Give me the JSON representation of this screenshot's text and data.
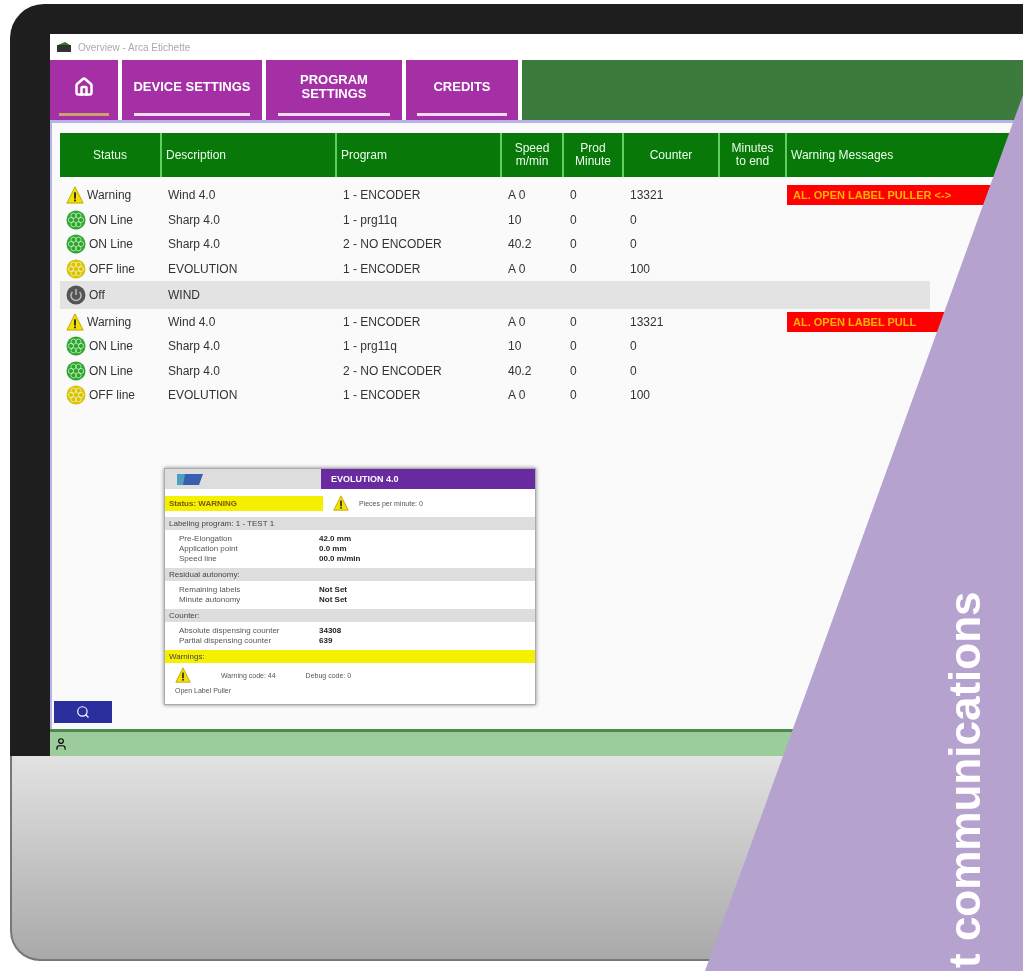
{
  "window": {
    "title": "Overview - Arca Etichette"
  },
  "nav": [
    {
      "kind": "home",
      "selected": true
    },
    {
      "kind": "text",
      "label": "DEVICE SETTINGS",
      "selected": false
    },
    {
      "kind": "text",
      "label": "PROGRAM\nSETTINGS",
      "selected": false
    },
    {
      "kind": "text",
      "label": "CREDITS",
      "selected": false
    }
  ],
  "table": {
    "columns": [
      "Status",
      "Description",
      "Program",
      "Speed\nm/min",
      "Prod\nMinute",
      "Counter",
      "Minutes\nto end",
      "Warning Messages"
    ],
    "rows": [
      {
        "kind": "warning",
        "status_label": "Warning",
        "description": "Wind 4.0",
        "program": "1 - ENCODER",
        "speed": "A 0",
        "prod": "0",
        "counter": "13321",
        "message": "AL. OPEN LABEL PULLER <->",
        "selected": false
      },
      {
        "kind": "online",
        "status_label": "ON Line",
        "description": "Sharp 4.0",
        "program": "1 - prg11q",
        "speed": "10",
        "prod": "0",
        "counter": "0",
        "selected": false
      },
      {
        "kind": "online",
        "status_label": "ON Line",
        "description": "Sharp 4.0",
        "program": "2 - NO ENCODER",
        "speed": "40.2",
        "prod": "0",
        "counter": "0",
        "selected": false
      },
      {
        "kind": "offline",
        "status_label": "OFF line",
        "description": "EVOLUTION",
        "program": "1 - ENCODER",
        "speed": "A 0",
        "prod": "0",
        "counter": "100",
        "selected": false
      },
      {
        "kind": "off",
        "status_label": "Off",
        "description": "WIND",
        "selected": true
      },
      {
        "kind": "warning",
        "status_label": "Warning",
        "description": "Wind 4.0",
        "program": "1 - ENCODER",
        "speed": "A 0",
        "prod": "0",
        "counter": "13321",
        "message": "AL. OPEN LABEL PULL",
        "selected": false
      },
      {
        "kind": "online",
        "status_label": "ON Line",
        "description": "Sharp 4.0",
        "program": "1 - prg11q",
        "speed": "10",
        "prod": "0",
        "counter": "0",
        "selected": false
      },
      {
        "kind": "online",
        "status_label": "ON Line",
        "description": "Sharp 4.0",
        "program": "2 - NO ENCODER",
        "speed": "40.2",
        "prod": "0",
        "counter": "0",
        "selected": false
      },
      {
        "kind": "offline",
        "status_label": "OFF line",
        "description": "EVOLUTION",
        "program": "1 - ENCODER",
        "speed": "A 0",
        "prod": "0",
        "counter": "100",
        "selected": false
      }
    ]
  },
  "popup": {
    "title": "EVOLUTION 4.0",
    "status": "Status: WARNING",
    "pieces": "Pieces per minute: 0",
    "sections": [
      {
        "kind": "plain",
        "title": "Labeling program: 1 - TEST 1",
        "items": [
          {
            "label": "Pre-Elongation",
            "value": "42.0 mm"
          },
          {
            "label": "Application point",
            "value": "0.0 mm"
          },
          {
            "label": "Speed line",
            "value": "00.0 m/min"
          }
        ]
      },
      {
        "kind": "plain",
        "title": "Residual autonomy:",
        "items": [
          {
            "label": "Remaining labels",
            "value": "Not Set"
          },
          {
            "label": "Minute autonomy",
            "value": "Not Set"
          }
        ]
      },
      {
        "kind": "plain",
        "title": "Counter:",
        "items": [
          {
            "label": "Absolute dispensing counter",
            "value": "34308"
          },
          {
            "label": "Partial dispensing counter",
            "value": "639"
          }
        ]
      },
      {
        "kind": "warning",
        "title": "Warnings:"
      }
    ],
    "warning_code": "Warning code: 44",
    "debug_code": "Debug code: 0",
    "message": "Open Label Puller"
  },
  "banner": {
    "text": "t communications"
  }
}
